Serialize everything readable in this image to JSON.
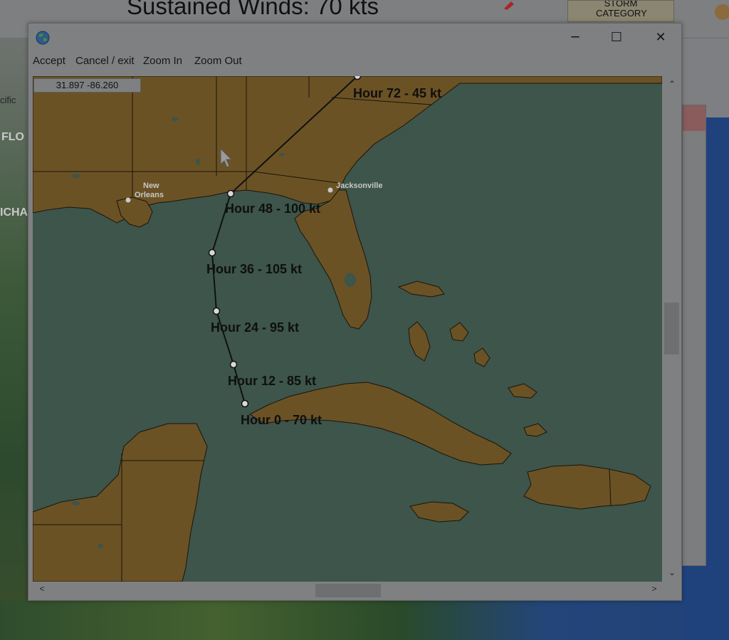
{
  "background": {
    "title": "Sustained Winds:  70 kts",
    "storm_category_label": "STORM CATEGORY",
    "left_label_a": "cific",
    "left_label_b": "FLO",
    "left_label_c": "ICHA"
  },
  "dialog": {
    "window_controls": {
      "minimize": "─",
      "maximize": "☐",
      "close": "✕"
    },
    "menu": {
      "accept": "Accept",
      "cancel": "Cancel / exit",
      "zoom_in": "Zoom In",
      "zoom_out": "Zoom Out"
    },
    "coordinates": "31.897 -86.260",
    "cities": [
      {
        "name": "New Orleans",
        "lines": [
          "New",
          "Orleans"
        ]
      },
      {
        "name": "Jacksonville",
        "lines": [
          "Jacksonville"
        ]
      }
    ],
    "forecast_track": [
      {
        "hour": 0,
        "label": "Hour 0 - 70 kt",
        "wind_kt": 70
      },
      {
        "hour": 12,
        "label": "Hour 12 - 85 kt",
        "wind_kt": 85
      },
      {
        "hour": 24,
        "label": "Hour 24 - 95 kt",
        "wind_kt": 95
      },
      {
        "hour": 36,
        "label": "Hour 36 - 105 kt",
        "wind_kt": 105
      },
      {
        "hour": 48,
        "label": "Hour 48 - 100 kt",
        "wind_kt": 100
      },
      {
        "hour": 72,
        "label": "Hour 72 - 45 kt",
        "wind_kt": 45
      }
    ],
    "scrollbar_glyphs": {
      "up": "⌃",
      "down": "⌄",
      "left": "<",
      "right": ">"
    }
  },
  "colors": {
    "land": "#6b5225",
    "water": "#3d554b",
    "track": "#111111",
    "dialog_bg": "#7f8082"
  }
}
